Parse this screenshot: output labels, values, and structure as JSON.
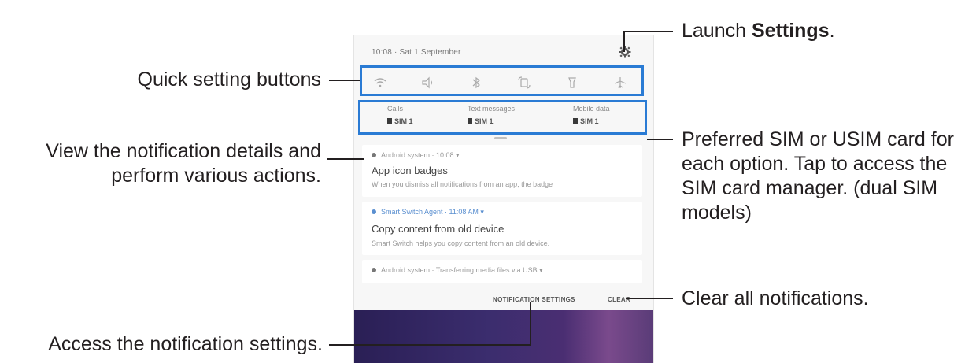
{
  "callouts": {
    "launch_settings_pre": "Launch ",
    "launch_settings_bold": "Settings",
    "launch_settings_post": ".",
    "quick_setting_buttons": "Quick setting buttons",
    "view_notification_line1": "View the notification details and",
    "view_notification_line2": "perform various actions.",
    "preferred_sim_line1": "Preferred SIM or USIM card for",
    "preferred_sim_line2": "each option. Tap to access the",
    "preferred_sim_line3": "SIM card manager. (dual SIM",
    "preferred_sim_line4": "models)",
    "clear_all": "Clear all notifications.",
    "access_settings": "Access the notification settings."
  },
  "phone": {
    "status": "10:08 · Sat 1 September",
    "quick_settings": [
      "wifi-icon",
      "sound-icon",
      "bluetooth-icon",
      "rotate-icon",
      "flashlight-icon",
      "airplane-icon"
    ],
    "sim": [
      {
        "label": "Calls",
        "value": "SIM 1"
      },
      {
        "label": "Text messages",
        "value": "SIM 1"
      },
      {
        "label": "Mobile data",
        "value": "SIM 1"
      }
    ],
    "notifications": [
      {
        "header": "Android system · 10:08",
        "title": "App icon badges",
        "body": "When you dismiss all notifications from an app, the badge"
      },
      {
        "header": "Smart Switch Agent · 11:08 AM",
        "title": "Copy content from old device",
        "body": "Smart Switch helps you copy content from an old device."
      },
      {
        "header": "Android system · Transferring media files via USB"
      }
    ],
    "actions": {
      "notification_settings": "NOTIFICATION SETTINGS",
      "clear": "CLEAR"
    }
  },
  "colors": {
    "highlight": "#2a7bd4",
    "text": "#231f20"
  }
}
